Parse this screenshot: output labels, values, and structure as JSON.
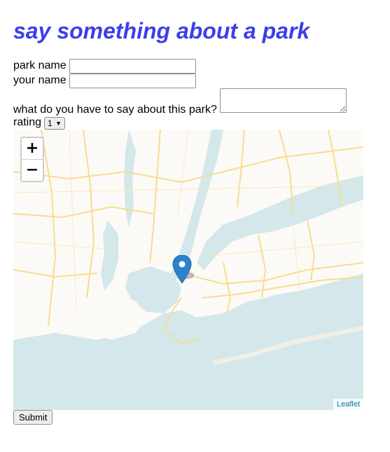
{
  "title": "say something about a park",
  "form": {
    "park_name_label": "park name",
    "park_name_value": "",
    "your_name_label": "your name",
    "your_name_value": "",
    "comment_label": "what do you have to say about this park?",
    "comment_value": "",
    "rating_label": "rating",
    "rating_value": "1",
    "submit_label": "Submit"
  },
  "map": {
    "zoom_in_label": "+",
    "zoom_out_label": "−",
    "attribution": "Leaflet",
    "marker_icon": "map-pin-icon",
    "colors": {
      "water": "#d4e7ea",
      "land": "#fcfaf6",
      "roads": "#f8dc8f",
      "marker": "#2a82cb"
    }
  }
}
